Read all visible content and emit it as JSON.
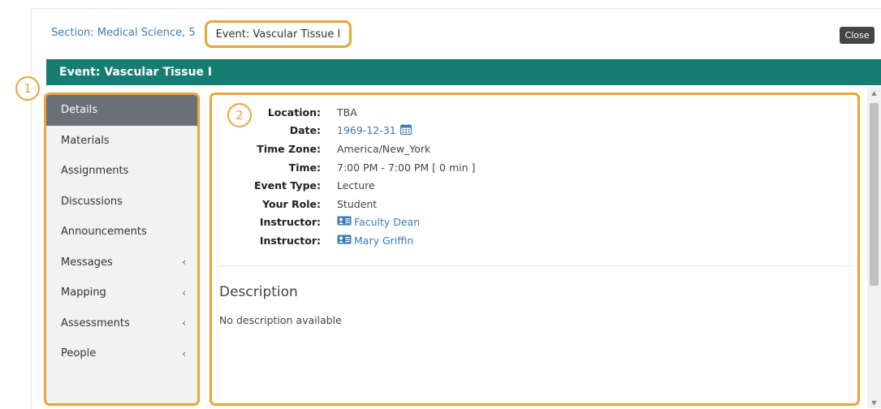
{
  "breadcrumb": {
    "section": "Section: Medical Science, 5",
    "event": "Event: Vascular Tissue I"
  },
  "close_label": "Close",
  "header_title": "Event: Vascular Tissue I",
  "callouts": {
    "one": "1",
    "two": "2"
  },
  "sidebar": {
    "items": [
      {
        "label": "Details",
        "active": true,
        "chevron": ""
      },
      {
        "label": "Materials",
        "chevron": ""
      },
      {
        "label": "Assignments",
        "chevron": ""
      },
      {
        "label": "Discussions",
        "chevron": ""
      },
      {
        "label": "Announcements",
        "chevron": ""
      },
      {
        "label": "Messages",
        "chevron": "‹"
      },
      {
        "label": "Mapping",
        "chevron": "‹"
      },
      {
        "label": "Assessments",
        "chevron": "‹"
      },
      {
        "label": "People",
        "chevron": "‹"
      }
    ]
  },
  "details": {
    "location": {
      "label": "Location:",
      "value": "TBA"
    },
    "date": {
      "label": "Date:",
      "value": "1969-12-31",
      "icon": "calendar-icon"
    },
    "timezone": {
      "label": "Time Zone:",
      "value": "America/New_York"
    },
    "time": {
      "label": "Time:",
      "value": "7:00 PM - 7:00 PM [ 0 min ]"
    },
    "event_type": {
      "label": "Event Type:",
      "value": "Lecture"
    },
    "role": {
      "label": "Your Role:",
      "value": "Student"
    },
    "instructors": [
      {
        "label": "Instructor:",
        "value": "Faculty Dean",
        "icon": "contact-card-icon"
      },
      {
        "label": "Instructor:",
        "value": "Mary Griffin",
        "icon": "contact-card-icon"
      }
    ]
  },
  "description": {
    "title": "Description",
    "text": "No description available"
  },
  "colors": {
    "header": "#167d73",
    "highlight": "#e8a538",
    "link": "#3a7bb5",
    "active_item": "#6b7079"
  }
}
